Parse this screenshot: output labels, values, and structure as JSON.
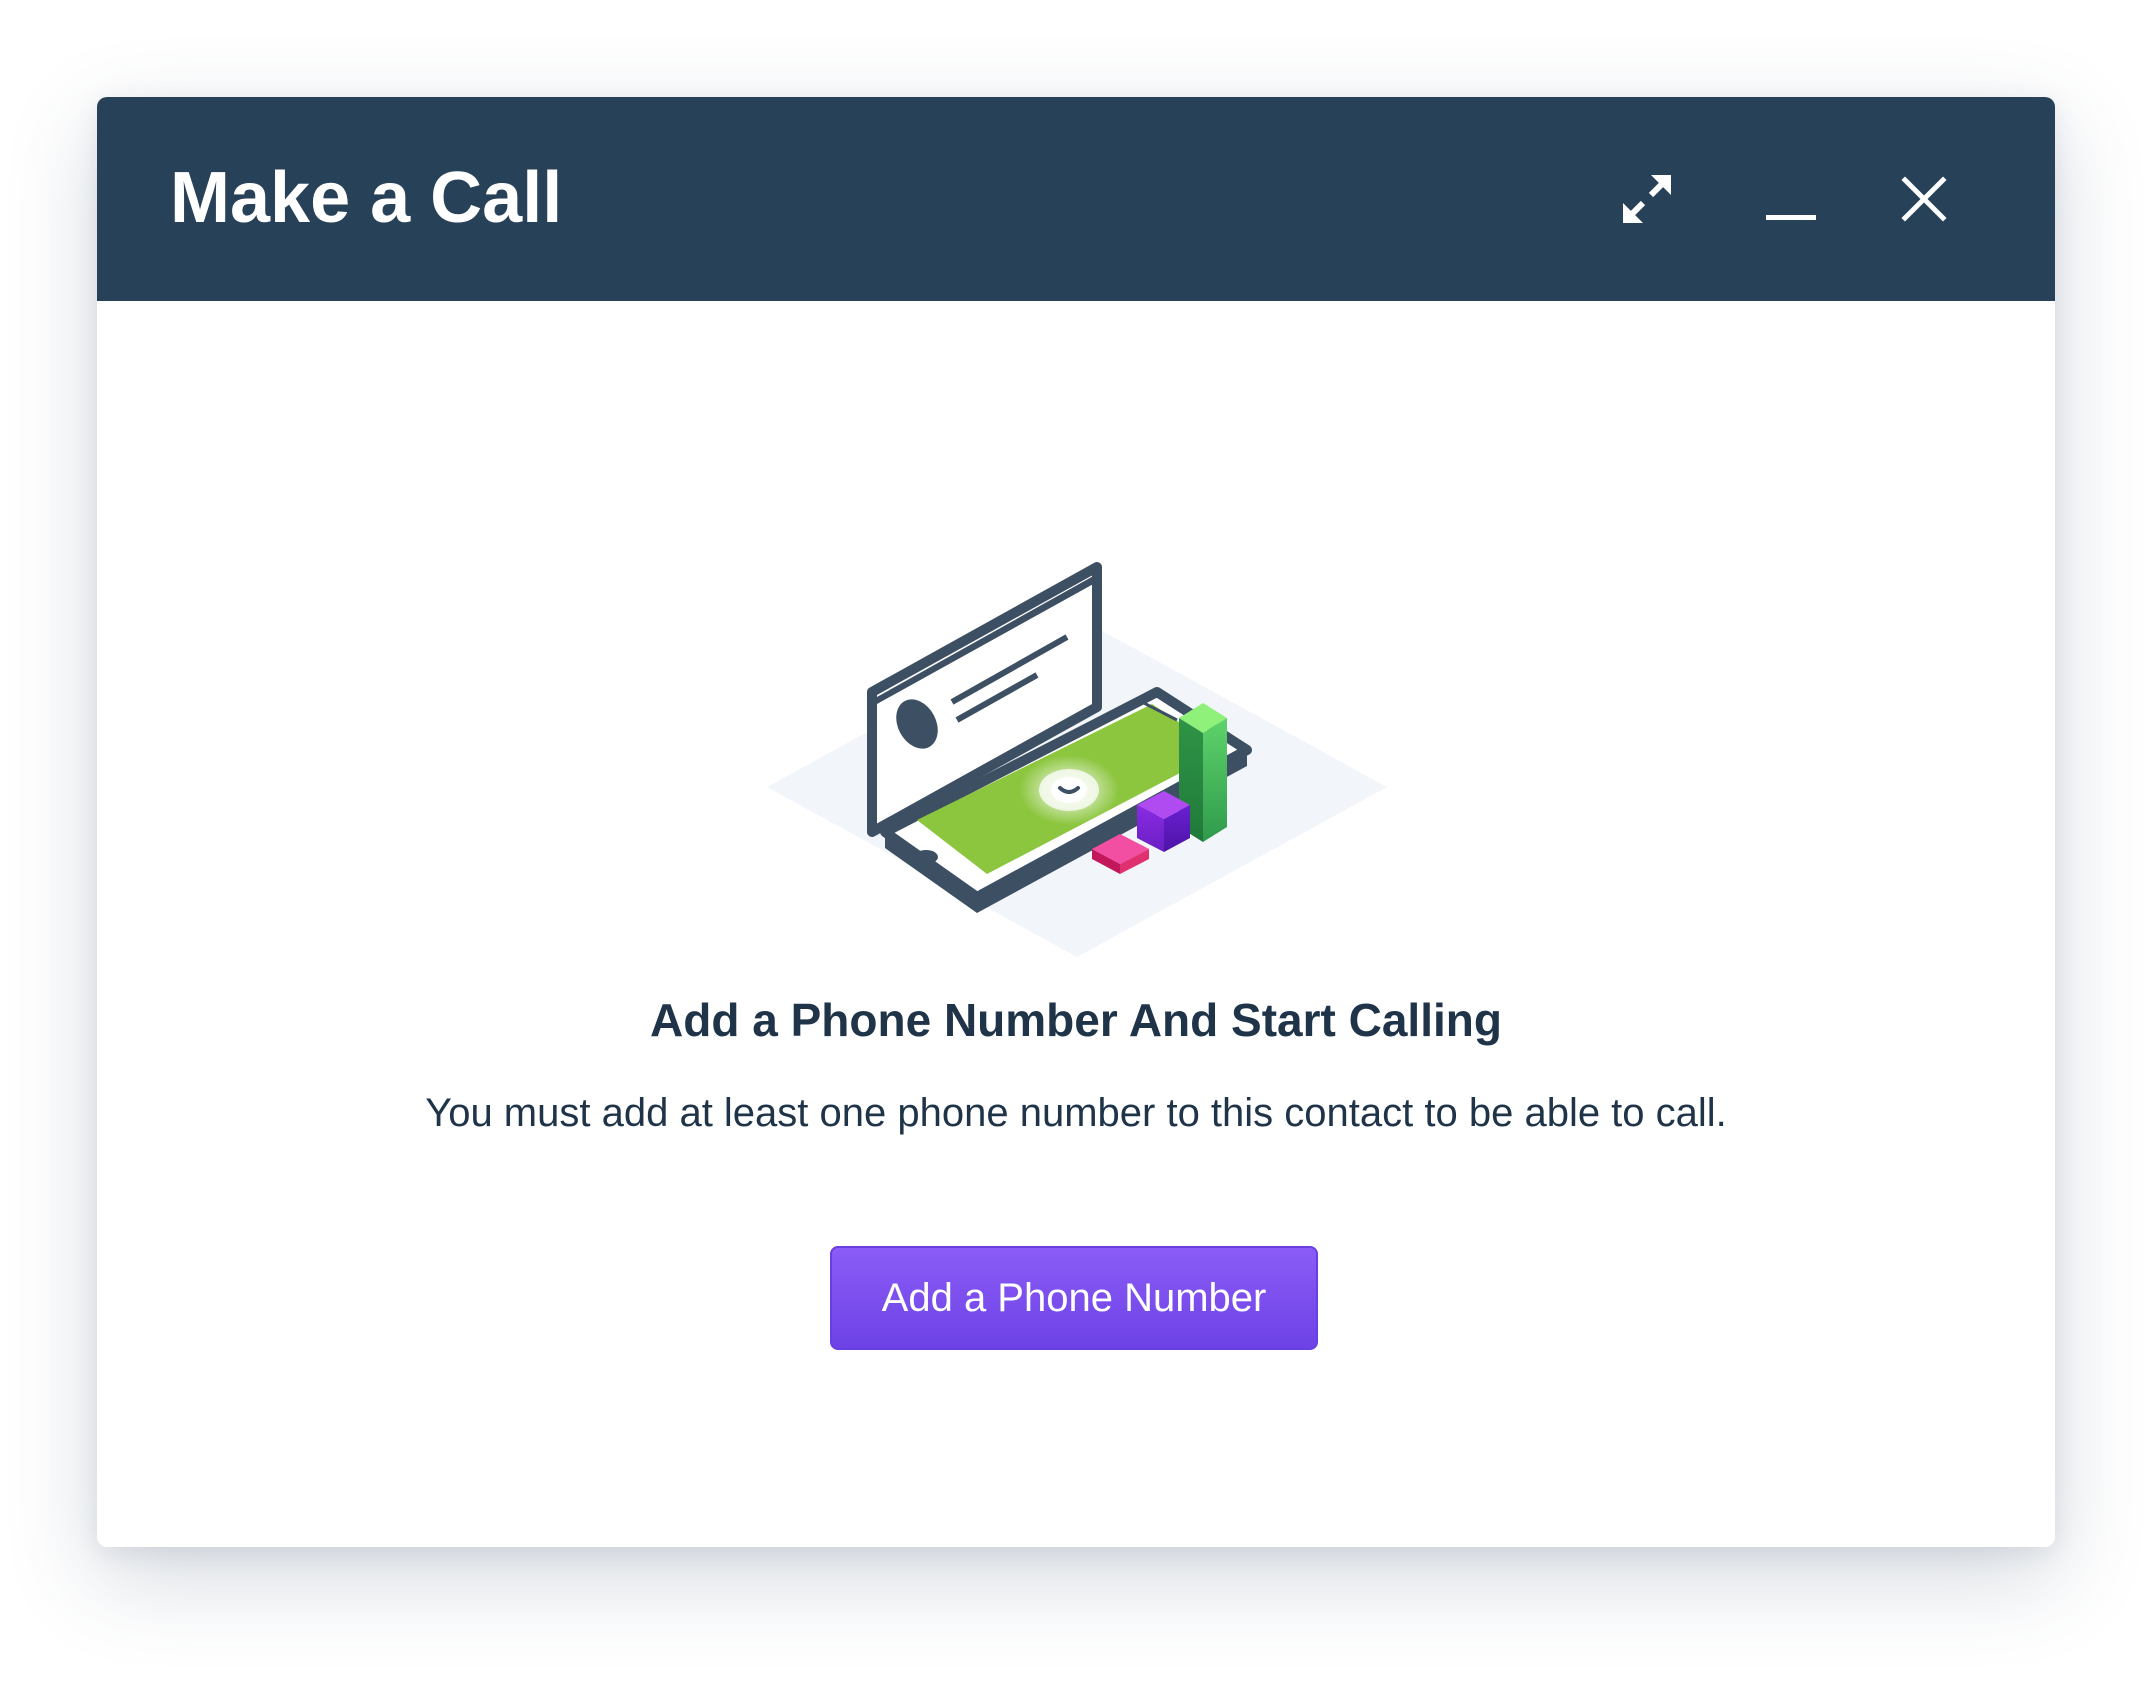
{
  "dialog": {
    "title": "Make a Call",
    "controls": {
      "expand_icon": "expand-arrows-icon",
      "minimize_icon": "minimize-icon",
      "close_icon": "close-icon"
    }
  },
  "empty_state": {
    "illustration": "phone-call-illustration",
    "heading": "Add a Phone Number And Start Calling",
    "message": "You must add at least one phone number to this contact to be able to call.",
    "button_label": "Add a Phone Number"
  },
  "colors": {
    "header_bg": "#274159",
    "header_text": "#ffffff",
    "text_dark": "#1f3448",
    "button_bg": "#7c4dee",
    "button_border": "#6a3fe0",
    "screen_green": "#8cc63f"
  }
}
